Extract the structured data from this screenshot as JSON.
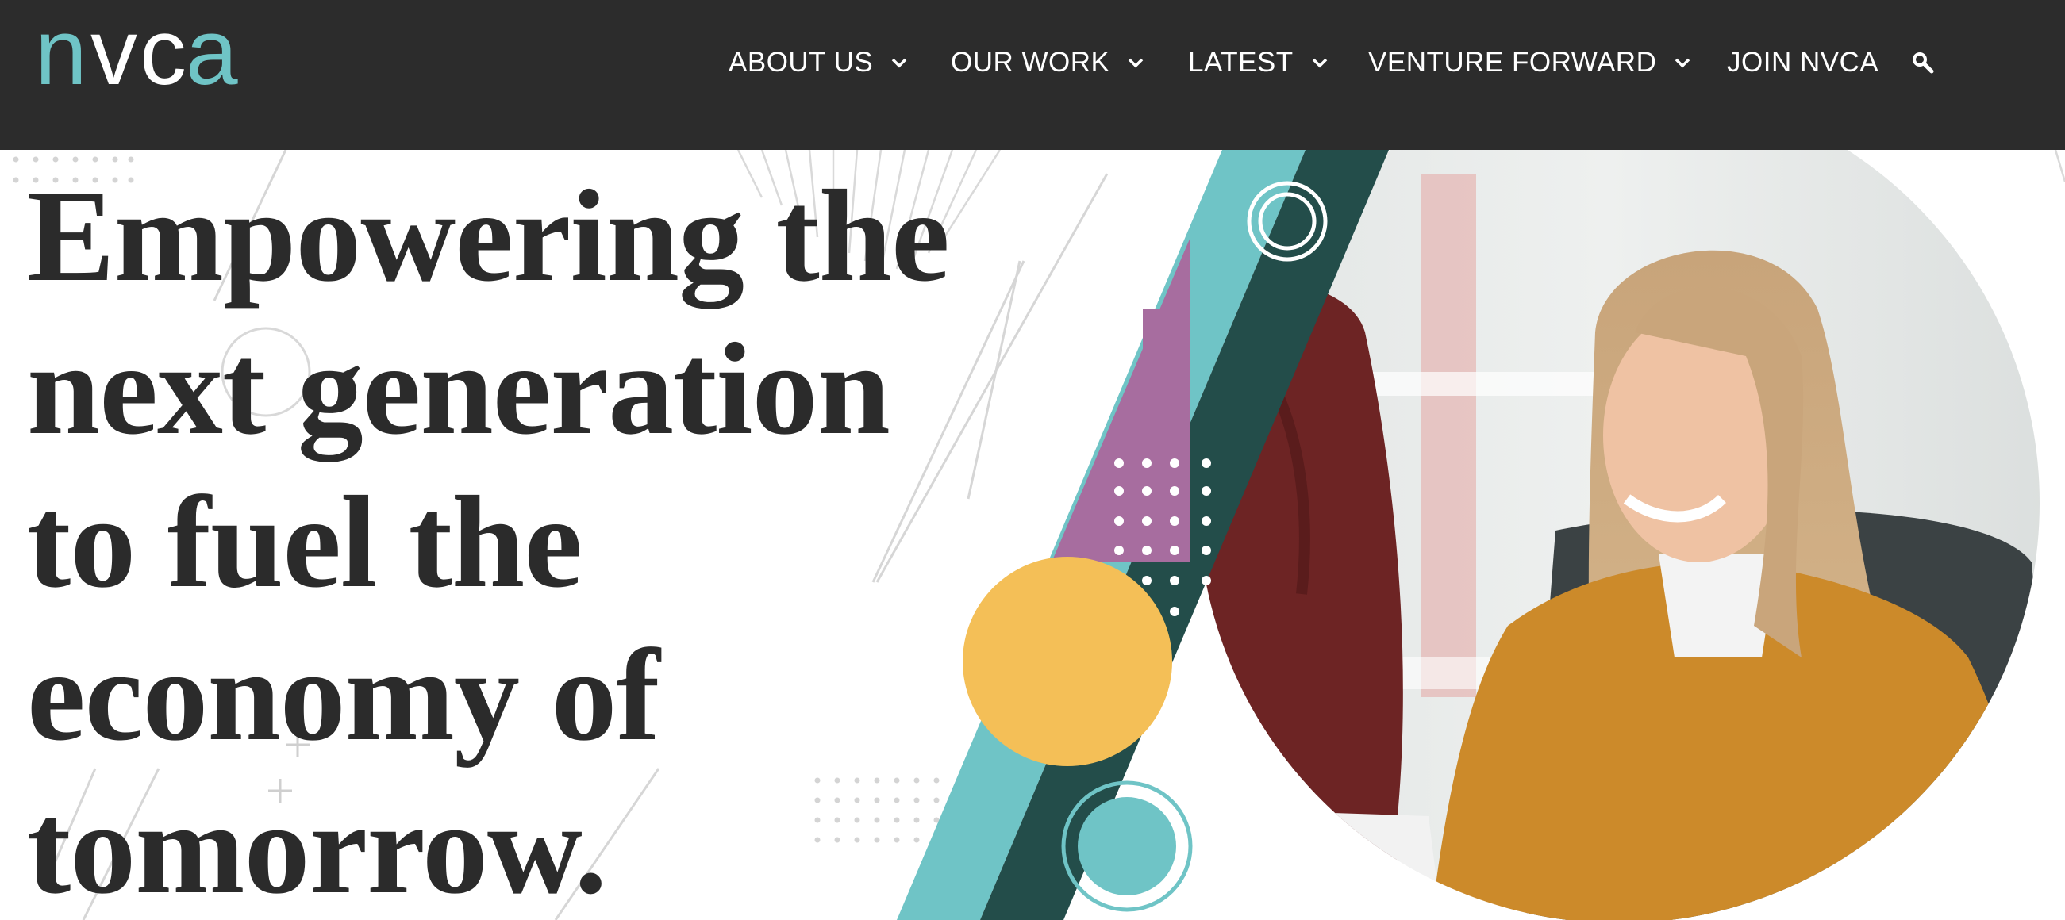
{
  "header": {
    "logo_text": "nvca",
    "nav": [
      {
        "label": "ABOUT US",
        "has_dropdown": true
      },
      {
        "label": "OUR WORK",
        "has_dropdown": true
      },
      {
        "label": "LATEST",
        "has_dropdown": true
      },
      {
        "label": "VENTURE FORWARD",
        "has_dropdown": true
      },
      {
        "label": "JOIN NVCA",
        "has_dropdown": false
      }
    ],
    "search_icon": "search-icon"
  },
  "hero": {
    "headline_lines": [
      "Empowering the",
      "next generation",
      "to fuel the",
      "economy of",
      "tomorrow."
    ]
  },
  "colors": {
    "header_bg": "#2c2c2c",
    "brand_teal": "#6fc4c6",
    "dark_teal": "#234d4a",
    "purple": "#a76d9f",
    "yellow": "#f4bf57",
    "text_dark": "#2b2b2b"
  }
}
